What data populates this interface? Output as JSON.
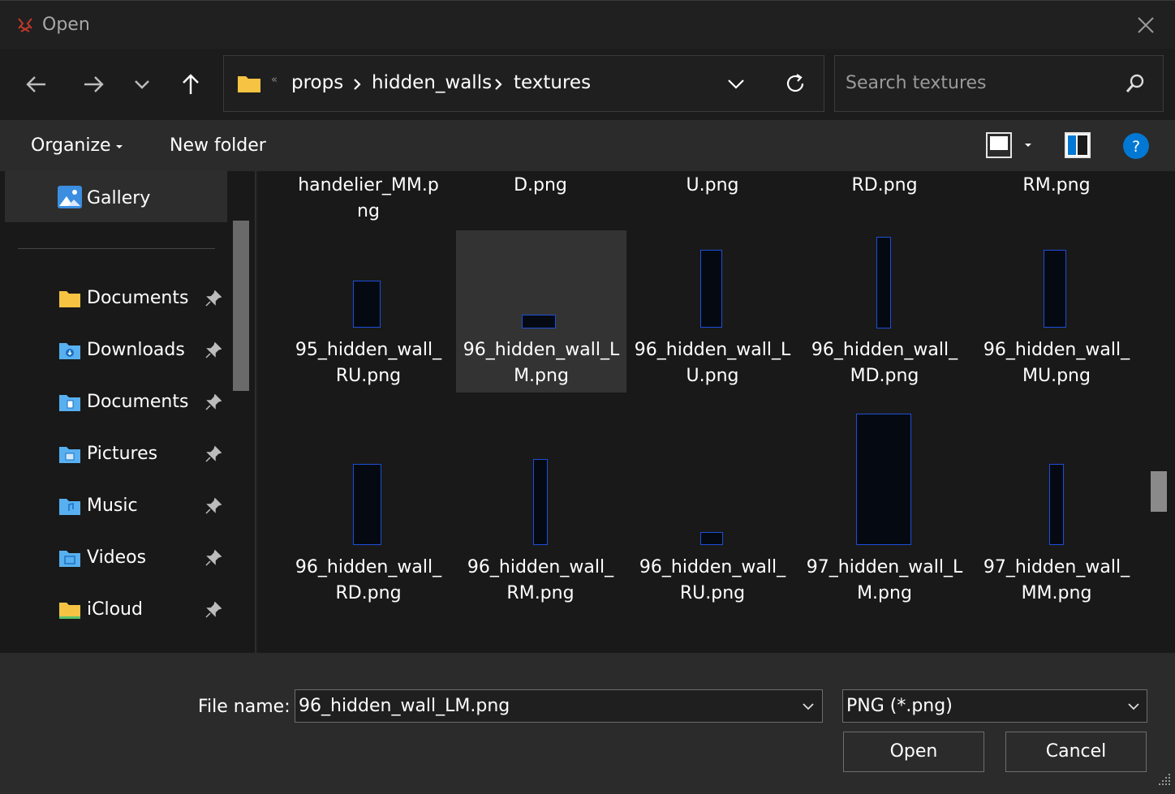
{
  "window": {
    "title": "Open"
  },
  "nav": {
    "breadcrumb": [
      "props",
      "hidden_walls",
      "textures"
    ],
    "overflow_marker": "«",
    "search_placeholder": "Search textures"
  },
  "toolbar": {
    "organize_label": "Organize",
    "new_folder_label": "New folder"
  },
  "sidebar": {
    "gallery_label": "Gallery",
    "items": [
      {
        "label": "Documents",
        "icon": "documents-folder-icon"
      },
      {
        "label": "Downloads",
        "icon": "downloads-folder-icon"
      },
      {
        "label": "Documents",
        "icon": "documents-folder-icon"
      },
      {
        "label": "Pictures",
        "icon": "pictures-folder-icon"
      },
      {
        "label": "Music",
        "icon": "music-folder-icon"
      },
      {
        "label": "Videos",
        "icon": "videos-folder-icon"
      },
      {
        "label": "iCloud",
        "icon": "icloud-folder-icon"
      }
    ]
  },
  "files": {
    "row0": [
      "handelier_MM.p\nng",
      "D.png",
      "U.png",
      "RD.png",
      "RM.png"
    ],
    "row1": [
      "95_hidden_wall_\nRU.png",
      "96_hidden_wall_L\nM.png",
      "96_hidden_wall_L\nU.png",
      "96_hidden_wall_\nMD.png",
      "96_hidden_wall_\nMU.png"
    ],
    "row2": [
      "96_hidden_wall_\nRD.png",
      "96_hidden_wall_\nRM.png",
      "96_hidden_wall_\nRU.png",
      "97_hidden_wall_L\nM.png",
      "97_hidden_wall_\nMM.png"
    ],
    "selected": "96_hidden_wall_LM.png"
  },
  "footer": {
    "file_name_label": "File name:",
    "file_name_value": "96_hidden_wall_LM.png",
    "file_type_value": "PNG (*.png)",
    "open_label": "Open",
    "cancel_label": "Cancel"
  },
  "colors": {
    "accent": "#0078d4",
    "folder": "#f6c343",
    "thumbnail_edge": "#1d4ed8"
  }
}
